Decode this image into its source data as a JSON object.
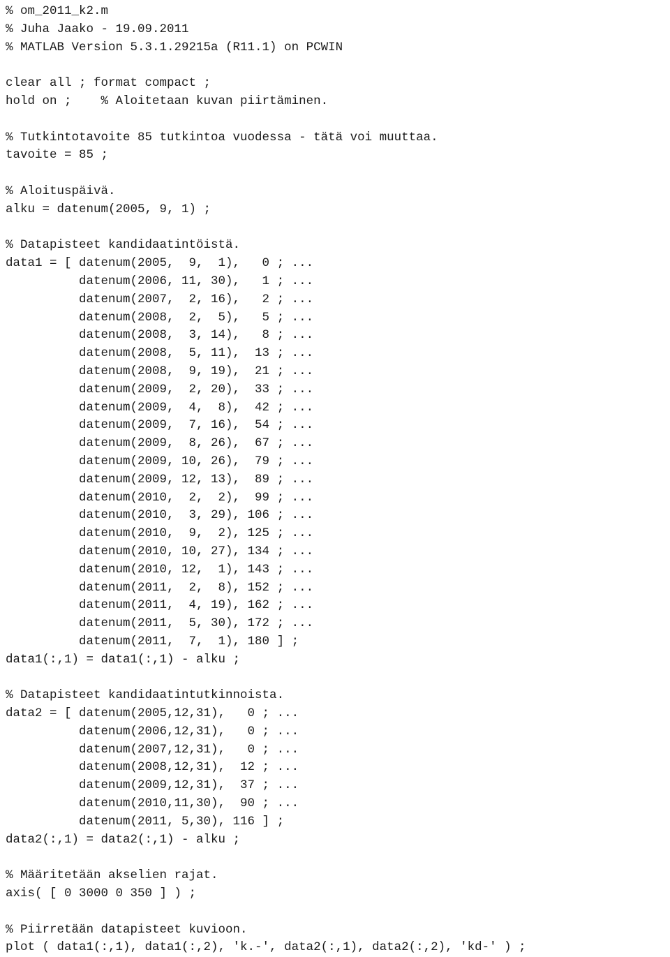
{
  "document": {
    "type": "matlab-source-listing",
    "file_name": "om_2011_k2.m",
    "author": "Juha Jaako",
    "date": "19.09.2011",
    "environment": "MATLAB Version 5.3.1.29215a (R11.1) on PCWIN",
    "text_color": "#1a1a1a",
    "background_color": "#ffffff"
  },
  "lines": [
    "% om_2011_k2.m",
    "% Juha Jaako - 19.09.2011",
    "% MATLAB Version 5.3.1.29215a (R11.1) on PCWIN",
    "",
    "clear all ; format compact ;",
    "hold on ;    % Aloitetaan kuvan piirtäminen.",
    "",
    "% Tutkintotavoite 85 tutkintoa vuodessa - tätä voi muuttaa.",
    "tavoite = 85 ;",
    "",
    "% Aloituspäivä.",
    "alku = datenum(2005, 9, 1) ;",
    "",
    "% Datapisteet kandidaatintöistä.",
    "data1 = [ datenum(2005,  9,  1),   0 ; ...",
    "          datenum(2006, 11, 30),   1 ; ...",
    "          datenum(2007,  2, 16),   2 ; ...",
    "          datenum(2008,  2,  5),   5 ; ...",
    "          datenum(2008,  3, 14),   8 ; ...",
    "          datenum(2008,  5, 11),  13 ; ...",
    "          datenum(2008,  9, 19),  21 ; ...",
    "          datenum(2009,  2, 20),  33 ; ...",
    "          datenum(2009,  4,  8),  42 ; ...",
    "          datenum(2009,  7, 16),  54 ; ...",
    "          datenum(2009,  8, 26),  67 ; ...",
    "          datenum(2009, 10, 26),  79 ; ...",
    "          datenum(2009, 12, 13),  89 ; ...",
    "          datenum(2010,  2,  2),  99 ; ...",
    "          datenum(2010,  3, 29), 106 ; ...",
    "          datenum(2010,  9,  2), 125 ; ...",
    "          datenum(2010, 10, 27), 134 ; ...",
    "          datenum(2010, 12,  1), 143 ; ...",
    "          datenum(2011,  2,  8), 152 ; ...",
    "          datenum(2011,  4, 19), 162 ; ...",
    "          datenum(2011,  5, 30), 172 ; ...",
    "          datenum(2011,  7,  1), 180 ] ;",
    "data1(:,1) = data1(:,1) - alku ;",
    "",
    "% Datapisteet kandidaatintutkinnoista.",
    "data2 = [ datenum(2005,12,31),   0 ; ...",
    "          datenum(2006,12,31),   0 ; ...",
    "          datenum(2007,12,31),   0 ; ...",
    "          datenum(2008,12,31),  12 ; ...",
    "          datenum(2009,12,31),  37 ; ...",
    "          datenum(2010,11,30),  90 ; ...",
    "          datenum(2011, 5,30), 116 ] ;",
    "data2(:,1) = data2(:,1) - alku ;",
    "",
    "% Määritetään akselien rajat.",
    "axis( [ 0 3000 0 350 ] ) ;",
    "",
    "% Piirretään datapisteet kuvioon.",
    "plot ( data1(:,1), data1(:,2), 'k.-', data2(:,1), data2(:,2), 'kd-' ) ;"
  ],
  "code_data": {
    "tavoite": 85,
    "alku": "datenum(2005, 9, 1)",
    "axis_limits": [
      0,
      3000,
      0,
      350
    ],
    "data1_label": "Datapisteet kandidaatintöistä.",
    "data1_rows": [
      {
        "year": 2005,
        "month": 9,
        "day": 1,
        "count": 0
      },
      {
        "year": 2006,
        "month": 11,
        "day": 30,
        "count": 1
      },
      {
        "year": 2007,
        "month": 2,
        "day": 16,
        "count": 2
      },
      {
        "year": 2008,
        "month": 2,
        "day": 5,
        "count": 5
      },
      {
        "year": 2008,
        "month": 3,
        "day": 14,
        "count": 8
      },
      {
        "year": 2008,
        "month": 5,
        "day": 11,
        "count": 13
      },
      {
        "year": 2008,
        "month": 9,
        "day": 19,
        "count": 21
      },
      {
        "year": 2009,
        "month": 2,
        "day": 20,
        "count": 33
      },
      {
        "year": 2009,
        "month": 4,
        "day": 8,
        "count": 42
      },
      {
        "year": 2009,
        "month": 7,
        "day": 16,
        "count": 54
      },
      {
        "year": 2009,
        "month": 8,
        "day": 26,
        "count": 67
      },
      {
        "year": 2009,
        "month": 10,
        "day": 26,
        "count": 79
      },
      {
        "year": 2009,
        "month": 12,
        "day": 13,
        "count": 89
      },
      {
        "year": 2010,
        "month": 2,
        "day": 2,
        "count": 99
      },
      {
        "year": 2010,
        "month": 3,
        "day": 29,
        "count": 106
      },
      {
        "year": 2010,
        "month": 9,
        "day": 2,
        "count": 125
      },
      {
        "year": 2010,
        "month": 10,
        "day": 27,
        "count": 134
      },
      {
        "year": 2010,
        "month": 12,
        "day": 1,
        "count": 143
      },
      {
        "year": 2011,
        "month": 2,
        "day": 8,
        "count": 152
      },
      {
        "year": 2011,
        "month": 4,
        "day": 19,
        "count": 162
      },
      {
        "year": 2011,
        "month": 5,
        "day": 30,
        "count": 172
      },
      {
        "year": 2011,
        "month": 7,
        "day": 1,
        "count": 180
      }
    ],
    "data2_label": "Datapisteet kandidaatintutkinnoista.",
    "data2_rows": [
      {
        "year": 2005,
        "month": 12,
        "day": 31,
        "count": 0
      },
      {
        "year": 2006,
        "month": 12,
        "day": 31,
        "count": 0
      },
      {
        "year": 2007,
        "month": 12,
        "day": 31,
        "count": 0
      },
      {
        "year": 2008,
        "month": 12,
        "day": 31,
        "count": 12
      },
      {
        "year": 2009,
        "month": 12,
        "day": 31,
        "count": 37
      },
      {
        "year": 2010,
        "month": 11,
        "day": 30,
        "count": 90
      },
      {
        "year": 2011,
        "month": 5,
        "day": 30,
        "count": 116
      }
    ],
    "plot_styles": [
      "k.-",
      "kd-"
    ]
  }
}
